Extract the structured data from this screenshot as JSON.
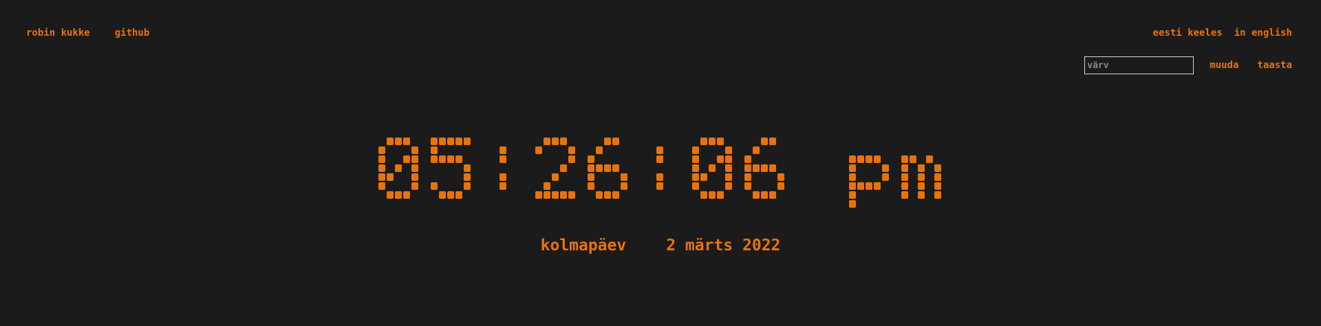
{
  "nav": {
    "author": "robin kukke",
    "github": "github"
  },
  "lang": {
    "estonian": "eesti keeles",
    "english": "in english"
  },
  "color_control": {
    "placeholder": "värv",
    "value": "",
    "change_label": "muuda",
    "reset_label": "taasta"
  },
  "clock": {
    "time": "05:26:06",
    "period": "pm"
  },
  "date": {
    "weekday": "kolmapäev",
    "full": "2 märts 2022"
  },
  "colors": {
    "background": "#1b1b1b",
    "accent": "#e8730c",
    "input_border": "#d8d8d8"
  }
}
